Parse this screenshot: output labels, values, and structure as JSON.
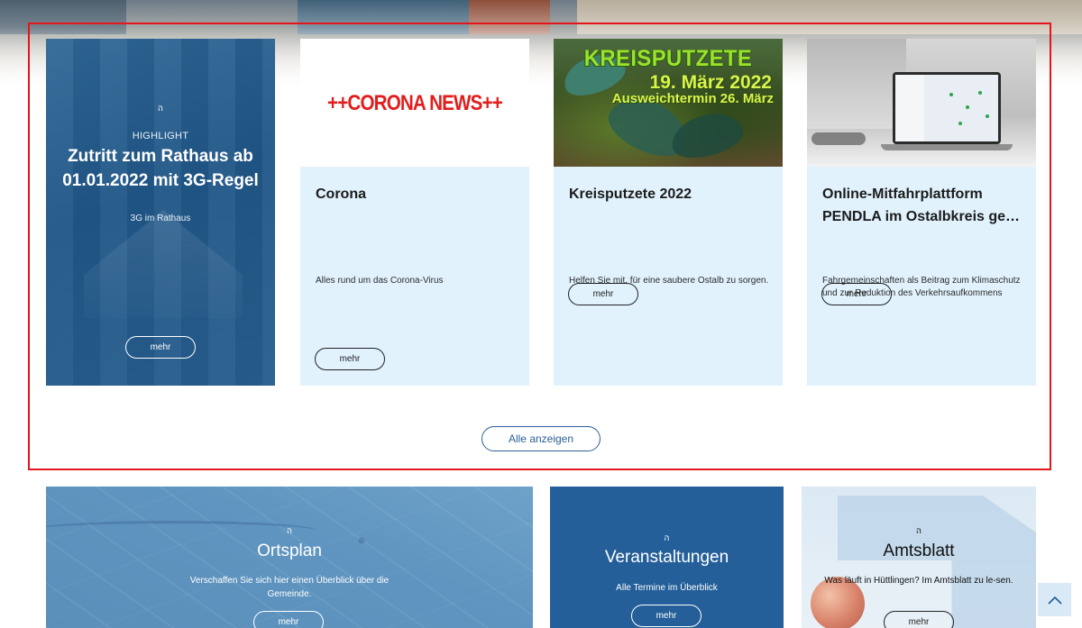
{
  "highlight_card": {
    "icon": "ornament-icon",
    "label": "HIGHLIGHT",
    "title": "Zutritt zum Rathaus ab 01.01.2022 mit 3G-Regel",
    "description": "3G im Rathaus",
    "button": "mehr"
  },
  "news_cards": [
    {
      "image_text": "++CORONA NEWS++",
      "title": "Corona",
      "description": "Alles rund um das Corona-Virus",
      "button": "mehr"
    },
    {
      "image_title": "KREISPUTZETE",
      "image_date": "19. März 2022",
      "image_alt_date": "Ausweichtermin 26. März",
      "title": "Kreisputzete 2022",
      "description": "Helfen Sie mit, für eine saubere Ostalb zu sorgen.",
      "button": "mehr"
    },
    {
      "title": "Online-Mitfahrplattform PENDLA im Ostalbkreis ge…",
      "description": "Fahrgemeinschaften als Beitrag zum Klimaschutz und zur Reduktion des Verkehrsaufkommens",
      "button": "mehr"
    }
  ],
  "show_all_button": "Alle anzeigen",
  "tiles": {
    "ortsplan": {
      "icon": "ornament-icon",
      "title": "Ortsplan",
      "text": "Verschaffen Sie sich hier einen Überblick über die Gemeinde.",
      "button": "mehr"
    },
    "veranstaltungen": {
      "icon": "ornament-icon",
      "title": "Veranstaltungen",
      "text": "Alle Termine im Überblick",
      "button": "mehr"
    },
    "amtsblatt": {
      "icon": "ornament-icon",
      "title": "Amtsblatt",
      "text": "Was läuft in Hüttlingen? Im Amtsblatt zu le-sen.",
      "button": "mehr"
    }
  },
  "scroll_top": {
    "icon": "chevron-up-icon"
  },
  "colors": {
    "highlight_frame": "#e3161b",
    "card_light_bg": "#e1f2fd",
    "primary_blue": "#245f99",
    "corona_red": "#e21d1d"
  }
}
